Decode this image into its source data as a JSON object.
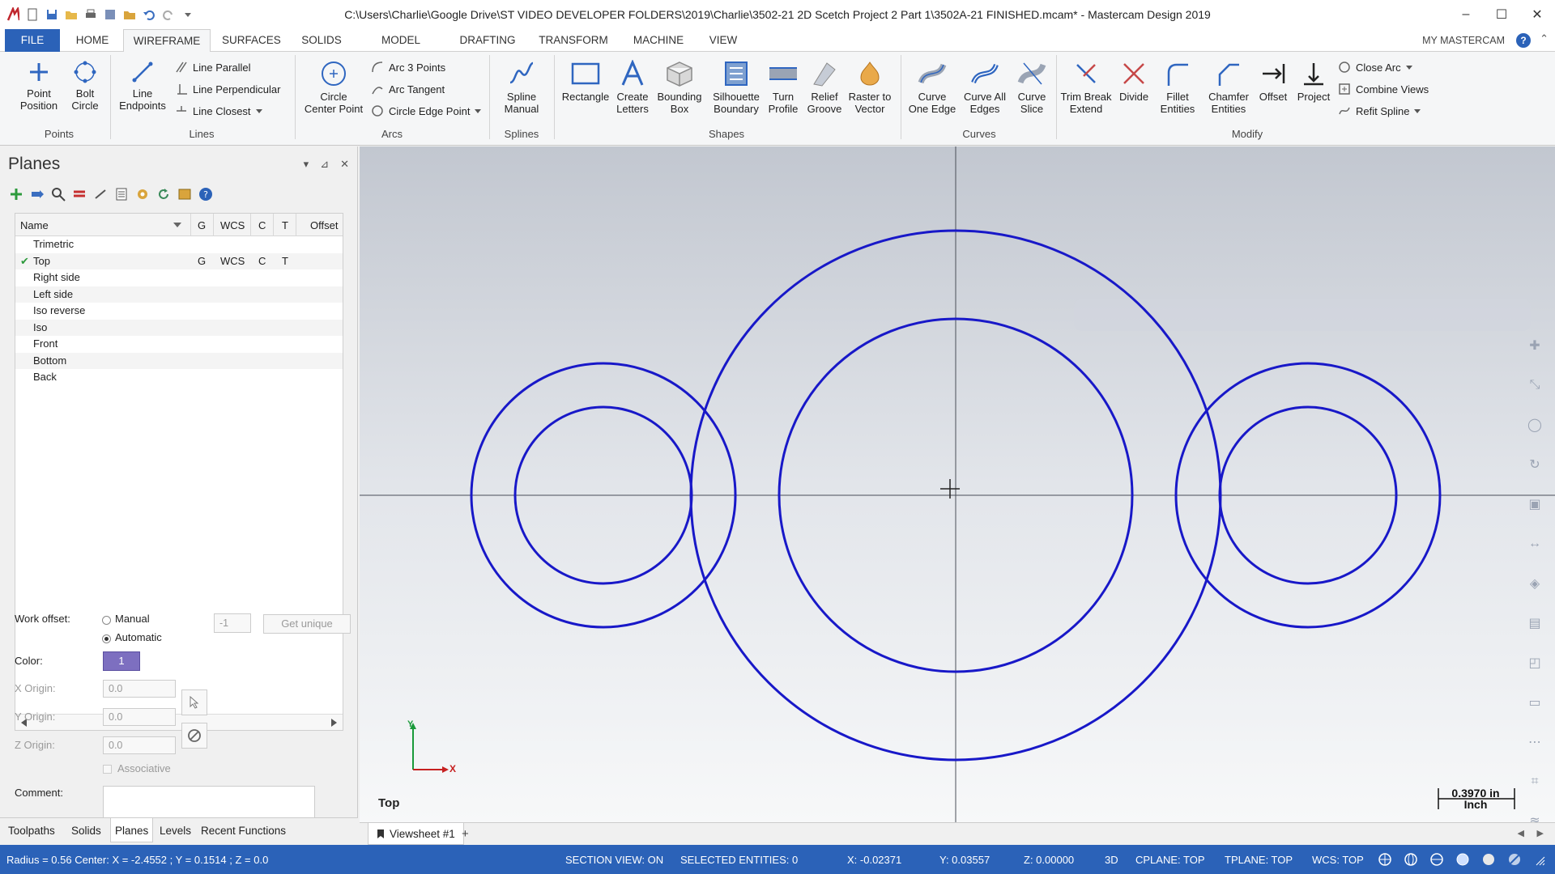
{
  "window": {
    "title": "C:\\Users\\Charlie\\Google Drive\\ST VIDEO DEVELOPER FOLDERS\\2019\\Charlie\\3502-21 2D Scetch Project 2 Part 1\\3502A-21 FINISHED.mcam* - Mastercam Design 2019",
    "minimize": "–",
    "maximize": "☐",
    "close": "✕"
  },
  "menu": {
    "file": "FILE",
    "tabs": [
      "HOME",
      "WIREFRAME",
      "SURFACES",
      "SOLIDS",
      "MODEL PREP",
      "DRAFTING",
      "TRANSFORM",
      "MACHINE",
      "VIEW"
    ],
    "active_tab": "WIREFRAME",
    "my_mastercam": "MY MASTERCAM",
    "help": "?",
    "collapse": "⌃"
  },
  "ribbon": {
    "groups": {
      "points": "Points",
      "lines": "Lines",
      "arcs": "Arcs",
      "splines": "Splines",
      "shapes": "Shapes",
      "curves": "Curves",
      "modify": "Modify"
    },
    "point_position": [
      "Point",
      "Position"
    ],
    "bolt_circle": [
      "Bolt",
      "Circle"
    ],
    "line_endpoints": [
      "Line",
      "Endpoints"
    ],
    "line_parallel": "Line Parallel",
    "line_perpendicular": "Line Perpendicular",
    "line_closest": "Line Closest",
    "circle_center_point": [
      "Circle",
      "Center Point"
    ],
    "arc_3_points": "Arc 3 Points",
    "arc_tangent": "Arc Tangent",
    "circle_edge_point": "Circle Edge Point",
    "spline_manual": [
      "Spline",
      "Manual"
    ],
    "rectangle": "Rectangle",
    "create_letters": [
      "Create",
      "Letters"
    ],
    "bounding_box": [
      "Bounding",
      "Box"
    ],
    "silhouette_boundary": [
      "Silhouette",
      "Boundary"
    ],
    "turn_profile": [
      "Turn",
      "Profile"
    ],
    "relief_groove": [
      "Relief",
      "Groove"
    ],
    "raster_to_vector": [
      "Raster to",
      "Vector"
    ],
    "curve_one_edge": [
      "Curve",
      "One Edge"
    ],
    "curve_all_edges": [
      "Curve All",
      "Edges"
    ],
    "curve_slice": [
      "Curve",
      "Slice"
    ],
    "trim_break_extend": [
      "Trim Break",
      "Extend"
    ],
    "divide": "Divide",
    "fillet_entities": [
      "Fillet",
      "Entities"
    ],
    "chamfer_entities": [
      "Chamfer",
      "Entities"
    ],
    "offset": "Offset",
    "project": "Project",
    "close_arc": "Close Arc",
    "combine_views": "Combine Views",
    "refit_spline": "Refit Spline"
  },
  "planes_panel": {
    "title": "Planes",
    "pin": "▾",
    "autohide": "⊿",
    "close": "✕",
    "columns": [
      "Name",
      "G",
      "WCS",
      "C",
      "T",
      "Offset"
    ],
    "rows": [
      {
        "name": "Trimetric",
        "g": "",
        "wcs": "",
        "c": "",
        "t": "",
        "check": ""
      },
      {
        "name": "Top",
        "g": "G",
        "wcs": "WCS",
        "c": "C",
        "t": "T",
        "check": "✔"
      },
      {
        "name": "Right side",
        "g": "",
        "wcs": "",
        "c": "",
        "t": "",
        "check": ""
      },
      {
        "name": "Left side",
        "g": "",
        "wcs": "",
        "c": "",
        "t": "",
        "check": ""
      },
      {
        "name": "Iso reverse",
        "g": "",
        "wcs": "",
        "c": "",
        "t": "",
        "check": ""
      },
      {
        "name": "Iso",
        "g": "",
        "wcs": "",
        "c": "",
        "t": "",
        "check": ""
      },
      {
        "name": "Front",
        "g": "",
        "wcs": "",
        "c": "",
        "t": "",
        "check": ""
      },
      {
        "name": "Bottom",
        "g": "",
        "wcs": "",
        "c": "",
        "t": "",
        "check": ""
      },
      {
        "name": "Back",
        "g": "",
        "wcs": "",
        "c": "",
        "t": "",
        "check": ""
      }
    ],
    "work_offset_label": "Work offset:",
    "manual": "Manual",
    "automatic": "Automatic",
    "offset_value": "-1",
    "get_unique": "Get unique",
    "color_label": "Color:",
    "color_value": "1",
    "x_origin_label": "X Origin:",
    "y_origin_label": "Y Origin:",
    "z_origin_label": "Z Origin:",
    "x_origin": "0.0",
    "y_origin": "0.0",
    "z_origin": "0.0",
    "associative": "Associative",
    "comment_label": "Comment:"
  },
  "bottom_tabs": [
    "Toolpaths",
    "Solids",
    "Planes",
    "Levels",
    "Recent Functions"
  ],
  "active_bottom_tab": "Planes",
  "viewport": {
    "view_name": "Top",
    "scale": [
      "0.3970 in",
      "Inch"
    ],
    "axis_x": "X",
    "axis_y": "Y",
    "viewsheet": "Viewsheet #1",
    "add_viewsheet": "+"
  },
  "status": {
    "info": "Radius = 0.56 Center: X = -2.4552 ; Y = 0.1514 ; Z = 0.0",
    "section_view": "SECTION VIEW: ON",
    "selected": "SELECTED ENTITIES: 0",
    "x": "X:  -0.02371",
    "y": "Y:  0.03557",
    "z": "Z:  0.00000",
    "mode": "3D",
    "cplane": "CPLANE: TOP",
    "tplane": "TPLANE: TOP",
    "wcs": "WCS: TOP"
  },
  "colors": {
    "accent": "#2b62b8",
    "geometry": "#1818c8"
  }
}
